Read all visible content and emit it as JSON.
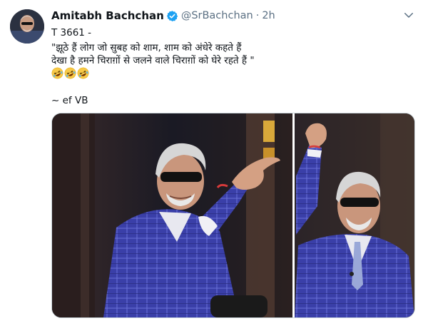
{
  "tweet": {
    "author_name": "Amitabh Bachchan",
    "handle": "@SrBachchan",
    "separator": "·",
    "time": "2h",
    "lines": [
      "T 3661 -",
      "\"झूठे हैं लोग जो सुबह को शाम, शाम को अंधेरे कहते हैं",
      "देखा है हमने चिराग़ों से जलने वाले चिराग़ों को घेरे रहते हैं  \"",
      "~ ef VB"
    ],
    "emojis": [
      "rolling-on-floor-laughing",
      "rolling-on-floor-laughing",
      "rolling-on-floor-laughing"
    ]
  },
  "icons": {
    "verified": "verified-badge-icon",
    "more": "chevron-down-icon",
    "emoji": "rofl-emoji-icon"
  },
  "colors": {
    "verified_blue": "#1da1f2",
    "text": "#0f1419",
    "secondary": "#5b7083",
    "emoji_yellow": "#f7c948",
    "suit_blue": "#3a3fa8"
  }
}
